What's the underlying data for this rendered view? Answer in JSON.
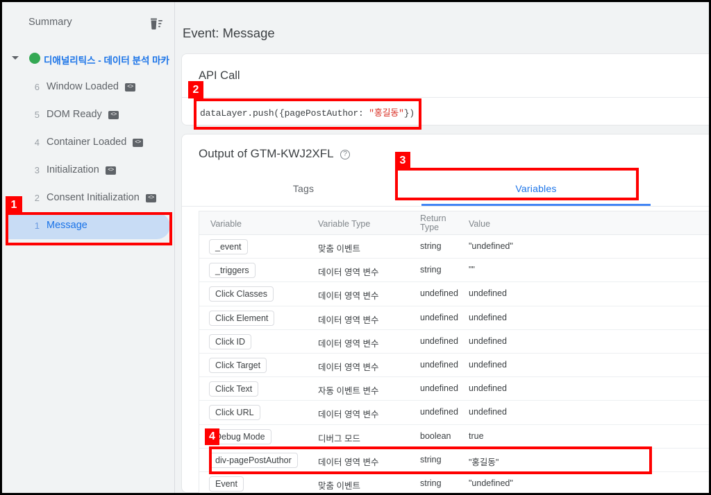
{
  "sidebar": {
    "title": "Summary",
    "trash_icon": "delete-all-icon",
    "container": {
      "name": "디애널리틱스 - 데이터 분석 마카",
      "status_color": "#34a853",
      "expanded": true
    },
    "events": [
      {
        "num": "6",
        "label": "Window Loaded",
        "badge": "<>",
        "selected": false
      },
      {
        "num": "5",
        "label": "DOM Ready",
        "badge": "<>",
        "selected": false
      },
      {
        "num": "4",
        "label": "Container Loaded",
        "badge": "<>",
        "selected": false
      },
      {
        "num": "3",
        "label": "Initialization",
        "badge": "<>",
        "selected": false
      },
      {
        "num": "2",
        "label": "Consent Initialization",
        "badge": "<>",
        "selected": false
      },
      {
        "num": "1",
        "label": "Message",
        "badge": "",
        "selected": true
      }
    ]
  },
  "main": {
    "event_title": "Event: Message",
    "api_call": {
      "title": "API Call",
      "code_prefix": "dataLayer.push({pagePostAuthor: ",
      "code_string": "\"홍길동\"",
      "code_suffix": "})",
      "string_color": "#d93025"
    },
    "output": {
      "title": "Output of GTM-KWJ2XFL",
      "help_icon": "help-circle-icon",
      "tabs": [
        {
          "label": "Tags",
          "active": false
        },
        {
          "label": "Variables",
          "active": true
        }
      ],
      "table": {
        "headers": {
          "variable": "Variable",
          "variable_type": "Variable Type",
          "return_type": "Return\nType",
          "value": "Value"
        },
        "rows": [
          {
            "variable": "_event",
            "variable_type": "맞춤 이벤트",
            "return_type": "string",
            "value": "\"undefined\""
          },
          {
            "variable": "_triggers",
            "variable_type": "데이터 영역 변수",
            "return_type": "string",
            "value": "\"\""
          },
          {
            "variable": "Click Classes",
            "variable_type": "데이터 영역 변수",
            "return_type": "undefined",
            "value": "undefined"
          },
          {
            "variable": "Click Element",
            "variable_type": "데이터 영역 변수",
            "return_type": "undefined",
            "value": "undefined"
          },
          {
            "variable": "Click ID",
            "variable_type": "데이터 영역 변수",
            "return_type": "undefined",
            "value": "undefined"
          },
          {
            "variable": "Click Target",
            "variable_type": "데이터 영역 변수",
            "return_type": "undefined",
            "value": "undefined"
          },
          {
            "variable": "Click Text",
            "variable_type": "자동 이벤트 변수",
            "return_type": "undefined",
            "value": "undefined"
          },
          {
            "variable": "Click URL",
            "variable_type": "데이터 영역 변수",
            "return_type": "undefined",
            "value": "undefined"
          },
          {
            "variable": "Debug Mode",
            "variable_type": "디버그 모드",
            "return_type": "boolean",
            "value": "true"
          },
          {
            "variable": "div-pagePostAuthor",
            "variable_type": "데이터 영역 변수",
            "return_type": "string",
            "value": "\"홍길동\""
          },
          {
            "variable": "Event",
            "variable_type": "맞춤 이벤트",
            "return_type": "string",
            "value": "\"undefined\""
          }
        ]
      }
    }
  },
  "annotations": {
    "color": "#ff0000",
    "items": [
      {
        "number": "1",
        "target": "sidebar-event-message"
      },
      {
        "number": "2",
        "target": "api-call-code"
      },
      {
        "number": "3",
        "target": "variables-tab"
      },
      {
        "number": "4",
        "target": "variable-row-div-pagePostAuthor"
      }
    ]
  }
}
